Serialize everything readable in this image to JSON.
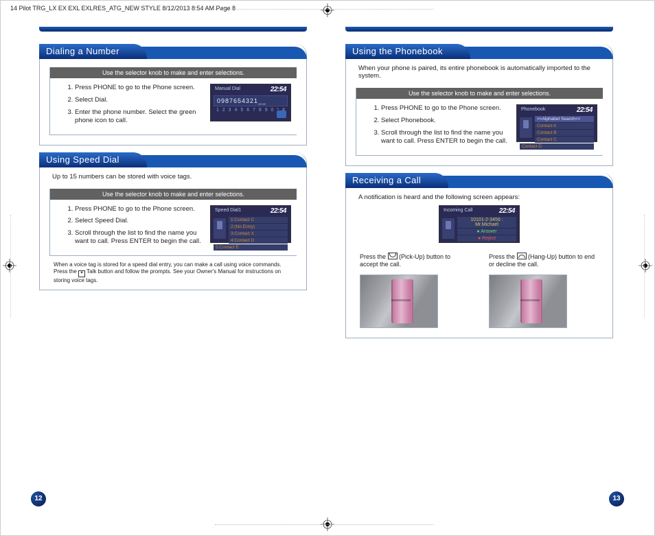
{
  "print_header": "14 Pilot TRG_LX EX EXL EXLRES_ATG_NEW STYLE  8/12/2013  8:54 AM  Page 8",
  "knob_instruction": "Use the selector knob to make and enter selections.",
  "dialing": {
    "title": "Dialing a Number",
    "steps": [
      "Press PHONE to go to the Phone screen.",
      "Select Dial.",
      "Enter the phone number. Select the green phone icon to call."
    ],
    "screenshot": {
      "title": "Manual Dial",
      "time": "22:54",
      "digits": "0987654321__",
      "keypad": "1 2 3 4 5 6 7 8 9 0 * #"
    }
  },
  "speed_dial": {
    "title": "Using Speed Dial",
    "intro": "Up to 15 numbers can be stored with voice tags.",
    "steps": [
      "Press PHONE to go to the Phone screen.",
      "Select Speed Dial.",
      "Scroll through the list to find the name you want to call. Press ENTER to begin the call."
    ],
    "screenshot": {
      "title": "Speed Dial1",
      "time": "22:54",
      "rows": [
        "1:Contact C",
        "2:(No Entry)",
        "3:Contact X",
        "4:Contact D",
        "5:Contact E"
      ]
    },
    "voice_note_a": "When a voice tag is stored for a speed dial entry, you can make a call using voice commands. Press the ",
    "voice_note_b": " Talk button and follow the prompts. See your Owner's Manual for instructions on storing voice tags."
  },
  "phonebook": {
    "title": "Using the Phonebook",
    "intro": "When your phone is paired, its entire phonebook is automatically imported to the system.",
    "steps": [
      "Press PHONE to go to the Phone screen.",
      "Select Phonebook.",
      "Scroll through the list to find the name you want to call. Press ENTER to begin the call."
    ],
    "screenshot": {
      "title": "Phonebook",
      "time": "22:54",
      "rows": [
        ">>Alphabet Search<<",
        "Contact A",
        "Contact B",
        "Contact C",
        "Contact D"
      ]
    }
  },
  "receiving": {
    "title": "Receiving a Call",
    "intro": "A notification is heard and the following screen appears:",
    "screenshot": {
      "title": "Incoming Call",
      "time": "22:54",
      "caller": "10101-2-3456 : Mr.Michael",
      "answer": "Answer",
      "reject": "Reject"
    },
    "pickup_a": "Press the ",
    "pickup_b": " (Pick-Up) button to accept the call.",
    "hangup_a": "Press the ",
    "hangup_b": " (Hang-Up) button to end or decline the call."
  },
  "page_left": "12",
  "page_right": "13"
}
